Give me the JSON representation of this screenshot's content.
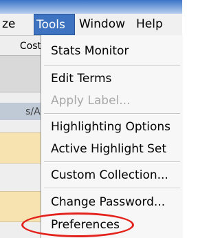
{
  "menubar": {
    "items": [
      {
        "label": "ze"
      },
      {
        "label": "Tools"
      },
      {
        "label": "Window"
      },
      {
        "label": "Help"
      }
    ]
  },
  "background": {
    "toolbar_label": "Cost",
    "path_label": "s/As"
  },
  "tools_menu": {
    "items": [
      {
        "label": "Stats Monitor",
        "enabled": true
      },
      {
        "label": "Edit Terms",
        "enabled": true
      },
      {
        "label": "Apply Label...",
        "enabled": false
      },
      {
        "label": "Highlighting Options",
        "enabled": true
      },
      {
        "label": "Active Highlight Set",
        "enabled": true
      },
      {
        "label": "Custom Collection...",
        "enabled": true
      },
      {
        "label": "Change Password...",
        "enabled": true
      },
      {
        "label": "Preferences",
        "enabled": true
      }
    ]
  },
  "colors": {
    "menu_highlight": "#3d73c0",
    "annotation": "#e3221c"
  }
}
